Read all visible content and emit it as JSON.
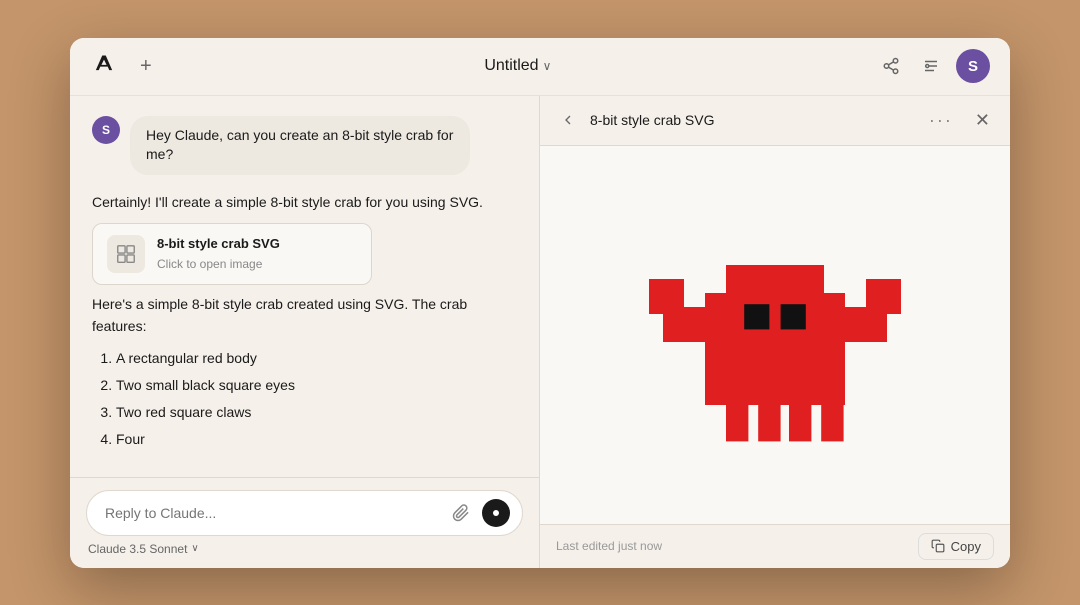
{
  "window": {
    "title": "Untitled",
    "chevron": "∨"
  },
  "header": {
    "new_chat_label": "+",
    "share_icon": "share",
    "settings_icon": "settings",
    "avatar_label": "S"
  },
  "chat": {
    "user_message": "Hey Claude, can you create an 8-bit style crab for me?",
    "assistant_intro": "Certainly! I'll create a simple 8-bit style crab for you using SVG.",
    "artifact": {
      "title": "8-bit style crab SVG",
      "subtitle": "Click to open image"
    },
    "description": "Here's a simple 8-bit style crab created using SVG. The crab features:",
    "features": [
      "A rectangular red body",
      "Two small black square eyes",
      "Two red square claws",
      "Four"
    ],
    "input_placeholder": "Reply to Claude...",
    "model_label": "Claude 3.5 Sonnet",
    "model_chevron": "∨"
  },
  "preview": {
    "title": "8-bit style crab SVG",
    "more_btn": "···",
    "last_edited": "Last edited just now",
    "copy_label": "Copy"
  }
}
